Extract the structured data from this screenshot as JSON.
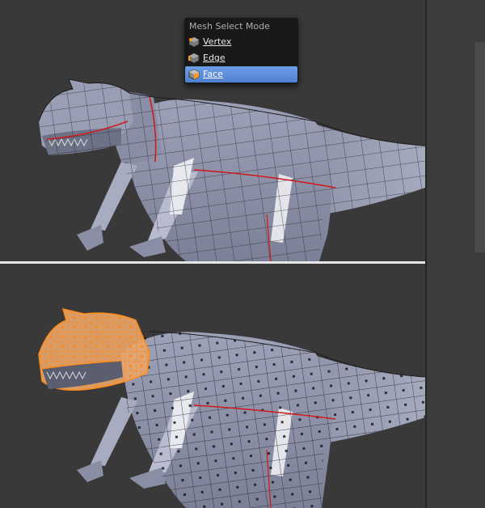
{
  "menu": {
    "title": "Mesh Select Mode",
    "items": [
      {
        "label": "Vertex",
        "icon": "vertex-select-icon",
        "active": false
      },
      {
        "label": "Edge",
        "icon": "edge-select-icon",
        "active": false
      },
      {
        "label": "Face",
        "icon": "face-select-icon",
        "active": true
      }
    ]
  },
  "colors": {
    "viewport_bg": "#393939",
    "mesh_face": "#8e92a8",
    "mesh_wire": "#1e1e1e",
    "seam": "#d01818",
    "selection": "#ff8a1a",
    "menu_bg": "#181818",
    "menu_highlight": "#5a8adc"
  }
}
